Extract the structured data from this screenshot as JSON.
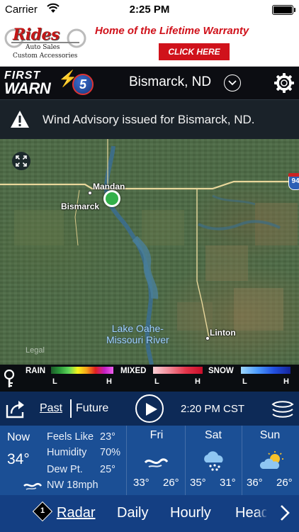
{
  "status_bar": {
    "carrier": "Carrier",
    "time": "2:25 PM",
    "battery_level": 1.0
  },
  "ad": {
    "logo_title": "Rides",
    "logo_sub1": "Auto Sales",
    "logo_sub2": "Custom Accessories",
    "headline": "Home of the Lifetime Warranty",
    "cta": "CLICK HERE",
    "colors": {
      "brand_red": "#d0121b"
    }
  },
  "header": {
    "brand_first": "FIRST",
    "brand_warn": "WARN",
    "brand_channel": "5",
    "location": "Bismarck, ND"
  },
  "advisory": {
    "text": "Wind Advisory issued for Bismarck, ND."
  },
  "map": {
    "cities": {
      "mandan": "Mandan",
      "bismarck": "Bismarck",
      "linton": "Linton"
    },
    "lake_line1": "Lake Oahe-",
    "lake_line2": "Missouri River",
    "legal": "Legal",
    "highway_shield": "94"
  },
  "legend": {
    "rain": "RAIN",
    "mixed": "MIXED",
    "snow": "SNOW",
    "low": "L",
    "high": "H"
  },
  "controls": {
    "past": "Past",
    "future": "Future",
    "frame_time": "2:20 PM CST"
  },
  "current": {
    "now_label": "Now",
    "temp": "34°",
    "feels_like_label": "Feels Like",
    "feels_like": "23°",
    "humidity_label": "Humidity",
    "humidity": "70%",
    "dew_point_label": "Dew Pt.",
    "dew_point": "25°",
    "wind": "NW 18mph"
  },
  "forecast": [
    {
      "day": "Fri",
      "icon": "wind-icon",
      "hi": "33°",
      "lo": "26°"
    },
    {
      "day": "Sat",
      "icon": "snow-cloud-icon",
      "hi": "35°",
      "lo": "31°"
    },
    {
      "day": "Sun",
      "icon": "partly-sunny-icon",
      "hi": "36°",
      "lo": "26°"
    }
  ],
  "tabs": {
    "badge": "1",
    "items": [
      "Radar",
      "Daily",
      "Hourly",
      "Headlines"
    ],
    "active": "Radar"
  }
}
